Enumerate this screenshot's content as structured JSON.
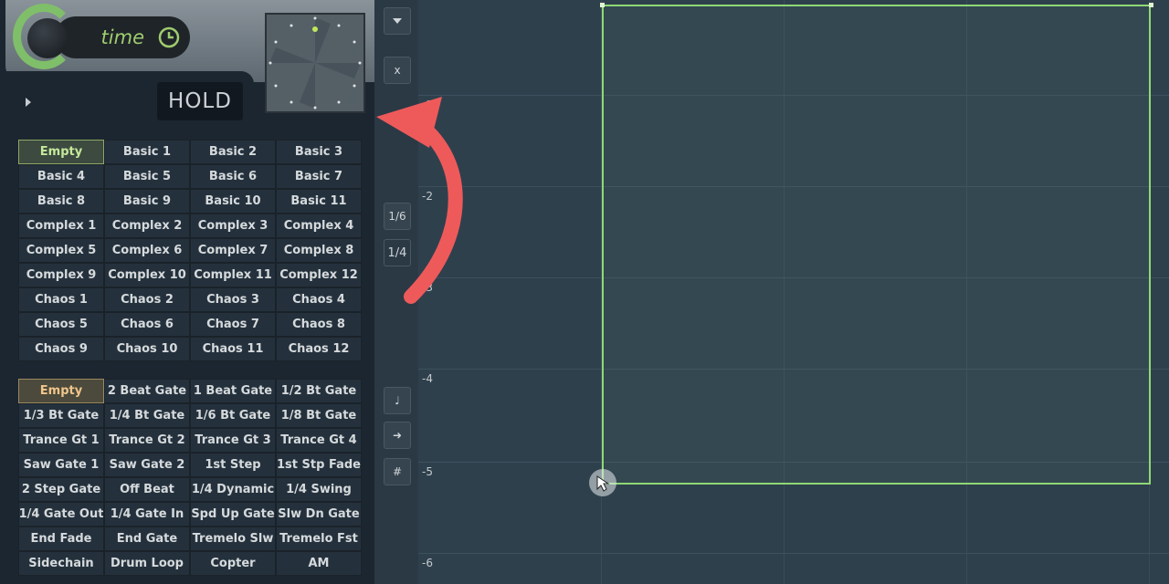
{
  "header": {
    "time_label": "time",
    "hold_label": "HOLD"
  },
  "presets_top": [
    "Empty",
    "Basic 1",
    "Basic 2",
    "Basic 3",
    "Basic 4",
    "Basic 5",
    "Basic 6",
    "Basic 7",
    "Basic 8",
    "Basic 9",
    "Basic 10",
    "Basic 11",
    "Complex 1",
    "Complex 2",
    "Complex 3",
    "Complex 4",
    "Complex 5",
    "Complex 6",
    "Complex 7",
    "Complex 8",
    "Complex 9",
    "Complex 10",
    "Complex 11",
    "Complex 12",
    "Chaos 1",
    "Chaos 2",
    "Chaos 3",
    "Chaos 4",
    "Chaos 5",
    "Chaos 6",
    "Chaos 7",
    "Chaos 8",
    "Chaos 9",
    "Chaos 10",
    "Chaos 11",
    "Chaos 12"
  ],
  "presets_bottom": [
    "Empty",
    "2 Beat Gate",
    "1 Beat Gate",
    "1/2 Bt Gate",
    "1/3 Bt Gate",
    "1/4 Bt Gate",
    "1/6 Bt Gate",
    "1/8 Bt Gate",
    "Trance Gt 1",
    "Trance Gt 2",
    "Trance Gt 3",
    "Trance Gt 4",
    "Saw Gate 1",
    "Saw Gate 2",
    "1st Step",
    "1st Stp Fade",
    "2 Step Gate",
    "Off Beat",
    "1/4 Dynamic",
    "1/4 Swing",
    "1/4 Gate Out",
    "1/4 Gate In",
    "Spd Up Gate",
    "Slw Dn Gate",
    "End Fade",
    "End Gate",
    "Tremelo Slw",
    "Tremelo Fst",
    "Sidechain",
    "Drum Loop",
    "Copter",
    "AM"
  ],
  "toolbar": {
    "btn_x": "x",
    "btn_16": "1/6",
    "btn_14": "1/4"
  },
  "graph": {
    "y_labels": [
      "-1",
      "-2",
      "-3",
      "-4",
      "-5",
      "-6"
    ]
  },
  "colors": {
    "accent_green": "#8fd876",
    "annotation_red": "#ee5a5a"
  }
}
